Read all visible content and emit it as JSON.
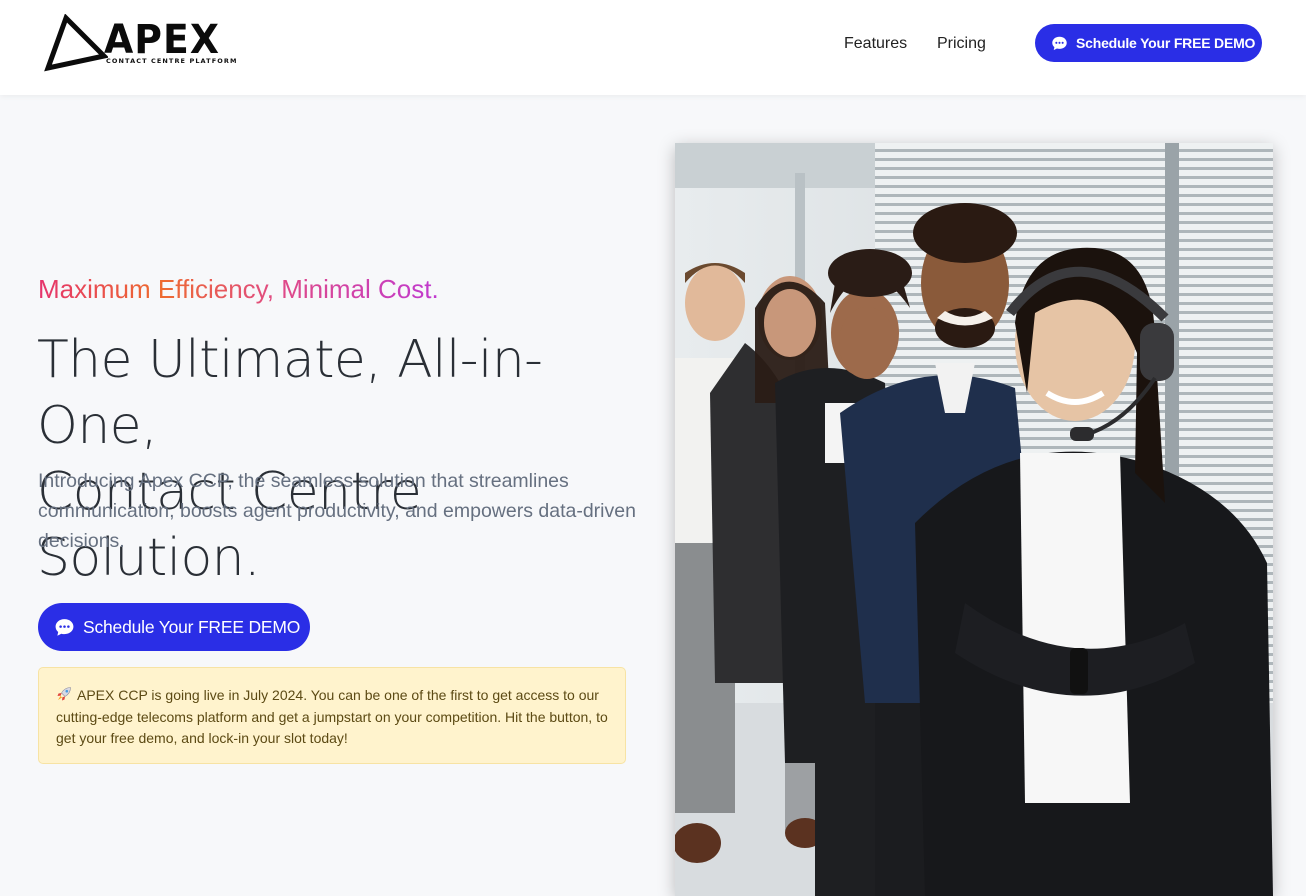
{
  "header": {
    "logo": {
      "wordmark": "APEX",
      "subtitle": "CONTACT CENTRE PLATFORM"
    },
    "nav": [
      {
        "label": "Features"
      },
      {
        "label": "Pricing"
      }
    ],
    "cta_label": "Schedule Your FREE DEMO"
  },
  "hero": {
    "tagline": "Maximum Efficiency, Minimal Cost.",
    "headline_line1": "The Ultimate, All-in-One,",
    "headline_line2": "Contact Centre Solution.",
    "intro": "Introducing Apex CCP, the seamless solution that streamlines communication, boosts agent productivity, and empowers data-driven decisions.",
    "cta_label": "Schedule Your FREE DEMO",
    "notice": "APEX CCP is going live in July 2024. You can be one of the first to get access to our cutting-edge telecoms platform and get a jumpstart on your competition. Hit the button, to get your free demo, and lock-in your slot today!"
  },
  "colors": {
    "brand_blue": "#2a2ee6",
    "notice_bg": "#fff3cd",
    "tagline_gradient": [
      "#e5336d",
      "#ee6b2e",
      "#e04a86",
      "#c03ad0"
    ]
  },
  "icons": {
    "cta": "chat-bubble-icon",
    "notice": "rocket-icon"
  }
}
